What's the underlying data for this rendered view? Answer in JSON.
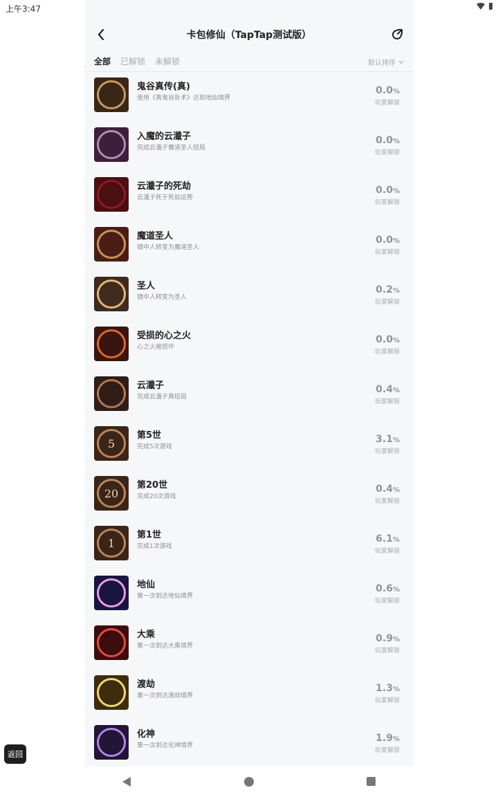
{
  "status": {
    "time": "上午3:47",
    "wifi_icon": "wifi-icon",
    "battery_icon": "battery-icon"
  },
  "header": {
    "title": "卡包修仙（TapTap测试版）",
    "back_icon": "back-arrow-icon",
    "share_icon": "share-icon"
  },
  "filters": {
    "tabs": [
      "全部",
      "已解锁",
      "未解锁"
    ],
    "active_tab": "全部",
    "sort_label": "默认排序"
  },
  "unlock_label": "玩家解锁",
  "percent_unit": "%",
  "achievements": [
    {
      "name": "鬼谷真传(真)",
      "desc": "使用《真鬼谷卦术》达到地仙境界",
      "percent": "0.0",
      "badge_glyph": "",
      "badge_color": "#3a2617",
      "ring_color": "#c79a63"
    },
    {
      "name": "入魔的云瀸子",
      "desc": "完成云瀸子魔道圣人结局",
      "percent": "0.0",
      "badge_glyph": "",
      "badge_color": "#3d1f3b",
      "ring_color": "#b48ab9"
    },
    {
      "name": "云瀸子的死劫",
      "desc": "云瀸子死于死劫运势",
      "percent": "0.0",
      "badge_glyph": "",
      "badge_color": "#4a0f12",
      "ring_color": "#8e1b1f"
    },
    {
      "name": "魔道圣人",
      "desc": "镜中人转变为魔道圣人",
      "percent": "0.0",
      "badge_glyph": "",
      "badge_color": "#4a1d14",
      "ring_color": "#c9925e"
    },
    {
      "name": "圣人",
      "desc": "镜中人转变为圣人",
      "percent": "0.2",
      "badge_glyph": "",
      "badge_color": "#3e2a1f",
      "ring_color": "#e0b877"
    },
    {
      "name": "受损的心之火",
      "desc": "心之火被损坏",
      "percent": "0.0",
      "badge_glyph": "",
      "badge_color": "#3a1510",
      "ring_color": "#d96a2d"
    },
    {
      "name": "云瀸子",
      "desc": "完成云瀸子真结局",
      "percent": "0.4",
      "badge_glyph": "",
      "badge_color": "#2f1d17",
      "ring_color": "#b07a56"
    },
    {
      "name": "第5世",
      "desc": "完成5次游戏",
      "percent": "3.1",
      "badge_glyph": "5",
      "badge_color": "#3b2418",
      "ring_color": "#b9865a"
    },
    {
      "name": "第20世",
      "desc": "完成20次游戏",
      "percent": "0.4",
      "badge_glyph": "20",
      "badge_color": "#3b2418",
      "ring_color": "#b9865a"
    },
    {
      "name": "第1世",
      "desc": "完成1次游戏",
      "percent": "6.1",
      "badge_glyph": "1",
      "badge_color": "#3b2418",
      "ring_color": "#b9865a"
    },
    {
      "name": "地仙",
      "desc": "第一次到达地仙境界",
      "percent": "0.6",
      "badge_glyph": "",
      "badge_color": "#1a1440",
      "ring_color": "#e7a2e0"
    },
    {
      "name": "大乘",
      "desc": "第一次到达大乘境界",
      "percent": "0.9",
      "badge_glyph": "",
      "badge_color": "#3c0d0f",
      "ring_color": "#e24c3f"
    },
    {
      "name": "渡劫",
      "desc": "第一次到达渡劫境界",
      "percent": "1.3",
      "badge_glyph": "",
      "badge_color": "#3d2d0c",
      "ring_color": "#f3d67a"
    },
    {
      "name": "化神",
      "desc": "第一次到达化神境界",
      "percent": "1.9",
      "badge_glyph": "",
      "badge_color": "#241436",
      "ring_color": "#b084e4"
    }
  ],
  "float_button": {
    "label": "返回"
  },
  "nav": {
    "back_icon": "nav-back-icon",
    "home_icon": "nav-home-icon",
    "recents_icon": "nav-recents-icon"
  }
}
